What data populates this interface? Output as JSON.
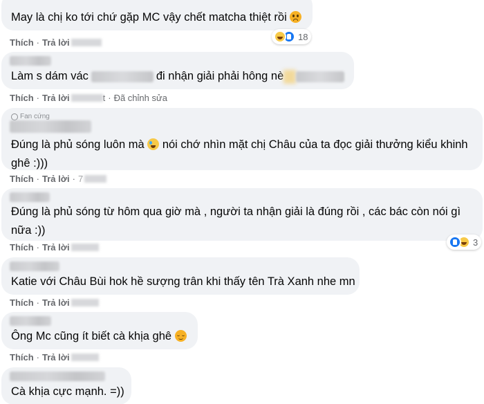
{
  "comments": [
    {
      "text": "May là chị ko tới chứ gặp MC vậy chết matcha thiệt rồi",
      "emoji": "frowning-face-emoji",
      "actions": {
        "like": "Thích",
        "reply": "Trả lời"
      },
      "reactions": {
        "icons": [
          "haha-reaction-icon",
          "like-reaction-icon"
        ],
        "count": "18"
      }
    },
    {
      "text_start": "Làm s dám vác",
      "text_mid": "đi nhận giải phải hông nè",
      "actions": {
        "like": "Thích",
        "reply": "Trả lời",
        "timestamp_suffix": "t",
        "edited": "Đã chỉnh sửa"
      }
    },
    {
      "badge": "Fan cứng",
      "text_start": "Đúng là phủ sóng luôn mà",
      "text_end": "nói chớ nhìn mặt chị Châu của ta đọc giải thưởng kiểu khinh ghê :)))",
      "emoji": "crying-laughing-emoji",
      "actions": {
        "like": "Thích",
        "reply": "Trả lời",
        "timestamp": "7"
      }
    },
    {
      "text": "Đúng là phủ sóng từ hôm qua giờ mà , người ta nhận giải là đúng rồi , các bác còn nói gì nữa :))",
      "actions": {
        "like": "Thích",
        "reply": "Trả lời"
      },
      "reactions": {
        "icons": [
          "like-reaction-icon",
          "haha-reaction-icon"
        ],
        "count": "3"
      }
    },
    {
      "text": "Katie với Châu Bùi hok hề sượng trân khi thấy tên Trà Xanh nhe mn",
      "actions": {
        "like": "Thích",
        "reply": "Trả lời"
      }
    },
    {
      "text": "Ông Mc cũng ít biết cà khịa ghê",
      "emoji": "relieved-face-emoji",
      "actions": {
        "like": "Thích",
        "reply": "Trả lời"
      }
    },
    {
      "text": "Cà khịa cực mạnh. =))"
    }
  ],
  "colors": {
    "bubble": "#f0f2f5",
    "text": "#050505",
    "meta": "#65676b",
    "like_blue": "#1877f2"
  }
}
